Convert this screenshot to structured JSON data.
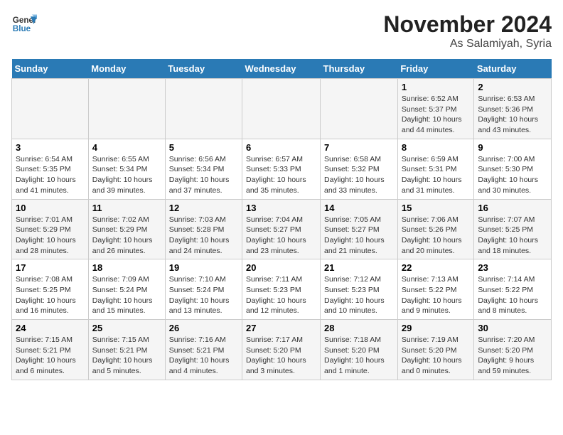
{
  "header": {
    "logo_line1": "General",
    "logo_line2": "Blue",
    "month": "November 2024",
    "location": "As Salamiyah, Syria"
  },
  "weekdays": [
    "Sunday",
    "Monday",
    "Tuesday",
    "Wednesday",
    "Thursday",
    "Friday",
    "Saturday"
  ],
  "weeks": [
    [
      {
        "day": "",
        "info": ""
      },
      {
        "day": "",
        "info": ""
      },
      {
        "day": "",
        "info": ""
      },
      {
        "day": "",
        "info": ""
      },
      {
        "day": "",
        "info": ""
      },
      {
        "day": "1",
        "info": "Sunrise: 6:52 AM\nSunset: 5:37 PM\nDaylight: 10 hours\nand 44 minutes."
      },
      {
        "day": "2",
        "info": "Sunrise: 6:53 AM\nSunset: 5:36 PM\nDaylight: 10 hours\nand 43 minutes."
      }
    ],
    [
      {
        "day": "3",
        "info": "Sunrise: 6:54 AM\nSunset: 5:35 PM\nDaylight: 10 hours\nand 41 minutes."
      },
      {
        "day": "4",
        "info": "Sunrise: 6:55 AM\nSunset: 5:34 PM\nDaylight: 10 hours\nand 39 minutes."
      },
      {
        "day": "5",
        "info": "Sunrise: 6:56 AM\nSunset: 5:34 PM\nDaylight: 10 hours\nand 37 minutes."
      },
      {
        "day": "6",
        "info": "Sunrise: 6:57 AM\nSunset: 5:33 PM\nDaylight: 10 hours\nand 35 minutes."
      },
      {
        "day": "7",
        "info": "Sunrise: 6:58 AM\nSunset: 5:32 PM\nDaylight: 10 hours\nand 33 minutes."
      },
      {
        "day": "8",
        "info": "Sunrise: 6:59 AM\nSunset: 5:31 PM\nDaylight: 10 hours\nand 31 minutes."
      },
      {
        "day": "9",
        "info": "Sunrise: 7:00 AM\nSunset: 5:30 PM\nDaylight: 10 hours\nand 30 minutes."
      }
    ],
    [
      {
        "day": "10",
        "info": "Sunrise: 7:01 AM\nSunset: 5:29 PM\nDaylight: 10 hours\nand 28 minutes."
      },
      {
        "day": "11",
        "info": "Sunrise: 7:02 AM\nSunset: 5:29 PM\nDaylight: 10 hours\nand 26 minutes."
      },
      {
        "day": "12",
        "info": "Sunrise: 7:03 AM\nSunset: 5:28 PM\nDaylight: 10 hours\nand 24 minutes."
      },
      {
        "day": "13",
        "info": "Sunrise: 7:04 AM\nSunset: 5:27 PM\nDaylight: 10 hours\nand 23 minutes."
      },
      {
        "day": "14",
        "info": "Sunrise: 7:05 AM\nSunset: 5:27 PM\nDaylight: 10 hours\nand 21 minutes."
      },
      {
        "day": "15",
        "info": "Sunrise: 7:06 AM\nSunset: 5:26 PM\nDaylight: 10 hours\nand 20 minutes."
      },
      {
        "day": "16",
        "info": "Sunrise: 7:07 AM\nSunset: 5:25 PM\nDaylight: 10 hours\nand 18 minutes."
      }
    ],
    [
      {
        "day": "17",
        "info": "Sunrise: 7:08 AM\nSunset: 5:25 PM\nDaylight: 10 hours\nand 16 minutes."
      },
      {
        "day": "18",
        "info": "Sunrise: 7:09 AM\nSunset: 5:24 PM\nDaylight: 10 hours\nand 15 minutes."
      },
      {
        "day": "19",
        "info": "Sunrise: 7:10 AM\nSunset: 5:24 PM\nDaylight: 10 hours\nand 13 minutes."
      },
      {
        "day": "20",
        "info": "Sunrise: 7:11 AM\nSunset: 5:23 PM\nDaylight: 10 hours\nand 12 minutes."
      },
      {
        "day": "21",
        "info": "Sunrise: 7:12 AM\nSunset: 5:23 PM\nDaylight: 10 hours\nand 10 minutes."
      },
      {
        "day": "22",
        "info": "Sunrise: 7:13 AM\nSunset: 5:22 PM\nDaylight: 10 hours\nand 9 minutes."
      },
      {
        "day": "23",
        "info": "Sunrise: 7:14 AM\nSunset: 5:22 PM\nDaylight: 10 hours\nand 8 minutes."
      }
    ],
    [
      {
        "day": "24",
        "info": "Sunrise: 7:15 AM\nSunset: 5:21 PM\nDaylight: 10 hours\nand 6 minutes."
      },
      {
        "day": "25",
        "info": "Sunrise: 7:15 AM\nSunset: 5:21 PM\nDaylight: 10 hours\nand 5 minutes."
      },
      {
        "day": "26",
        "info": "Sunrise: 7:16 AM\nSunset: 5:21 PM\nDaylight: 10 hours\nand 4 minutes."
      },
      {
        "day": "27",
        "info": "Sunrise: 7:17 AM\nSunset: 5:20 PM\nDaylight: 10 hours\nand 3 minutes."
      },
      {
        "day": "28",
        "info": "Sunrise: 7:18 AM\nSunset: 5:20 PM\nDaylight: 10 hours\nand 1 minute."
      },
      {
        "day": "29",
        "info": "Sunrise: 7:19 AM\nSunset: 5:20 PM\nDaylight: 10 hours\nand 0 minutes."
      },
      {
        "day": "30",
        "info": "Sunrise: 7:20 AM\nSunset: 5:20 PM\nDaylight: 9 hours\nand 59 minutes."
      }
    ]
  ]
}
